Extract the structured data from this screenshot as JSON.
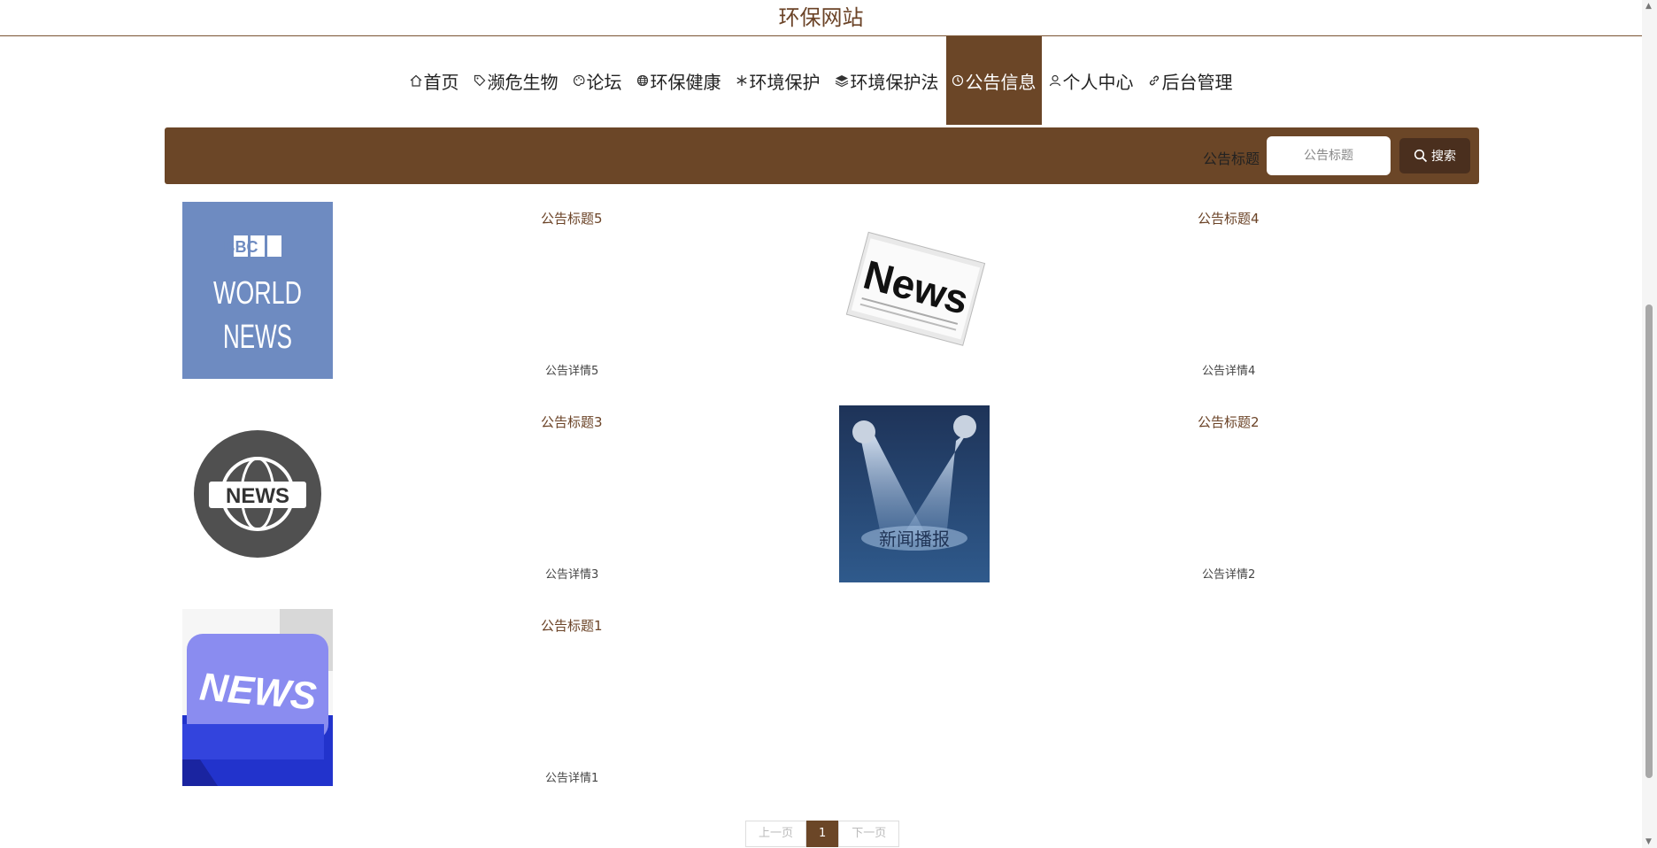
{
  "site_title": "环保网站",
  "nav": [
    {
      "icon": "home-icon",
      "label": "首页",
      "active": false
    },
    {
      "icon": "tag-icon",
      "label": "濒危生物",
      "active": false
    },
    {
      "icon": "palette-icon",
      "label": "论坛",
      "active": false
    },
    {
      "icon": "globe-icon",
      "label": "环保健康",
      "active": false
    },
    {
      "icon": "snowflake-icon",
      "label": "环境保护",
      "active": false
    },
    {
      "icon": "layers-icon",
      "label": "环境保护法",
      "active": false
    },
    {
      "icon": "clock-icon",
      "label": "公告信息",
      "active": true
    },
    {
      "icon": "user-icon",
      "label": "个人中心",
      "active": false
    },
    {
      "icon": "link-icon",
      "label": "后台管理",
      "active": false
    }
  ],
  "search": {
    "label": "公告标题",
    "placeholder": "公告标题",
    "button": "搜索"
  },
  "notices": [
    {
      "title": "公告标题5",
      "detail": "公告详情5",
      "image": "bbc-world-news-image",
      "image_text": [
        "BBC",
        "WORLD",
        "NEWS"
      ]
    },
    {
      "title": "公告标题4",
      "detail": "公告详情4",
      "image": "newspaper-image",
      "image_text": [
        "News"
      ]
    },
    {
      "title": "公告标题3",
      "detail": "公告详情3",
      "image": "globe-news-image",
      "image_text": [
        "NEWS"
      ]
    },
    {
      "title": "公告标题2",
      "detail": "公告详情2",
      "image": "spotlight-news-image",
      "image_text": [
        "新闻播报"
      ]
    },
    {
      "title": "公告标题1",
      "detail": "公告详情1",
      "image": "news-key-image",
      "image_text": [
        "NEWS"
      ]
    }
  ],
  "pagination": {
    "prev": "上一页",
    "current": "1",
    "next": "下一页"
  },
  "colors": {
    "brand": "#6b4627",
    "title": "#6b4327"
  }
}
